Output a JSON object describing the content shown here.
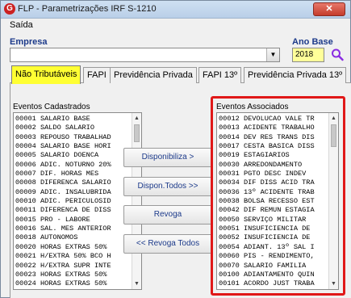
{
  "window": {
    "title": "FLP - Parametrizações IRF S-1210",
    "icon_letter": "G",
    "close_symbol": "✕"
  },
  "menu": {
    "items": [
      {
        "label": "Saída"
      }
    ]
  },
  "empresa": {
    "label": "Empresa",
    "value": ""
  },
  "ano": {
    "label": "Ano Base",
    "value": "2018"
  },
  "tabs": [
    {
      "label": "Não Tributáveis",
      "active": true
    },
    {
      "label": "FAPI",
      "active": false
    },
    {
      "label": "Previdência Privada",
      "active": false
    },
    {
      "label": "FAPI 13º",
      "active": false
    },
    {
      "label": "Previdência Privada 13º",
      "active": false
    }
  ],
  "eventos_cadastrados": {
    "label": "Eventos Cadastrados",
    "items": [
      "00001 SALARIO BASE",
      "00002 SALDO SALARIO",
      "00003 REPOUSO TRABALHAD",
      "00004 SALARIO BASE HORI",
      "00005 SALARIO DOENCA",
      "00006 ADIC. NOTURNO 20%",
      "00007 DIF. HORAS MES",
      "00008 DIFERENCA SALARIO",
      "00009 ADIC. INSALUBRIDA",
      "00010 ADIC. PERICULOSID",
      "00011 DIFERENCA DE DISS",
      "00015 PRO - LABORE",
      "00016 SAL. MES ANTERIOR",
      "00018 AUTONOMOS",
      "00020 HORAS EXTRAS 50%",
      "00021 H/EXTRA 50% BCO H",
      "00022 H/EXTRA SUPR INTE",
      "00023 HORAS EXTRAS 50%",
      "00024 HORAS EXTRAS 50%"
    ]
  },
  "eventos_associados": {
    "label": "Eventos Associados",
    "items": [
      "00012 DEVOLUCAO VALE TR",
      "00013 ACIDENTE TRABALHO",
      "00014 DEV RES TRANS DIS",
      "00017 CESTA BASICA DISS",
      "00019 ESTAGIARIOS",
      "00030 ARREDONDAMENTO",
      "00031 PGTO DESC INDEV",
      "00034 DIF DISS ACID TRA",
      "00036 13º ACIDENTE TRAB",
      "00038 BOLSA RECESSO EST",
      "00042 DIF REMUN ESTAGIA",
      "00050 SERVIÇO MILITAR",
      "00051 INSUFICIENCIA DE",
      "00052 INSUFICIENCIA DE",
      "00054 ADIANT. 13º SAL I",
      "00060 PIS - RENDIMENTO,",
      "00070 SALARIO FAMILIA",
      "00100 ADIANTAMENTO QUIN",
      "00101 ACORDO JUST TRABA"
    ]
  },
  "buttons": {
    "disponibiliza": "Disponibiliza >",
    "dispon_todos": "Dispon.Todos >>",
    "revoga": "Revoga",
    "revoga_todos": "<< Revoga Todos"
  },
  "colors": {
    "active_tab": "#ffff33",
    "highlight": "#e01818",
    "label_blue": "#1c3a8a",
    "ano_field": "#ffff99"
  }
}
